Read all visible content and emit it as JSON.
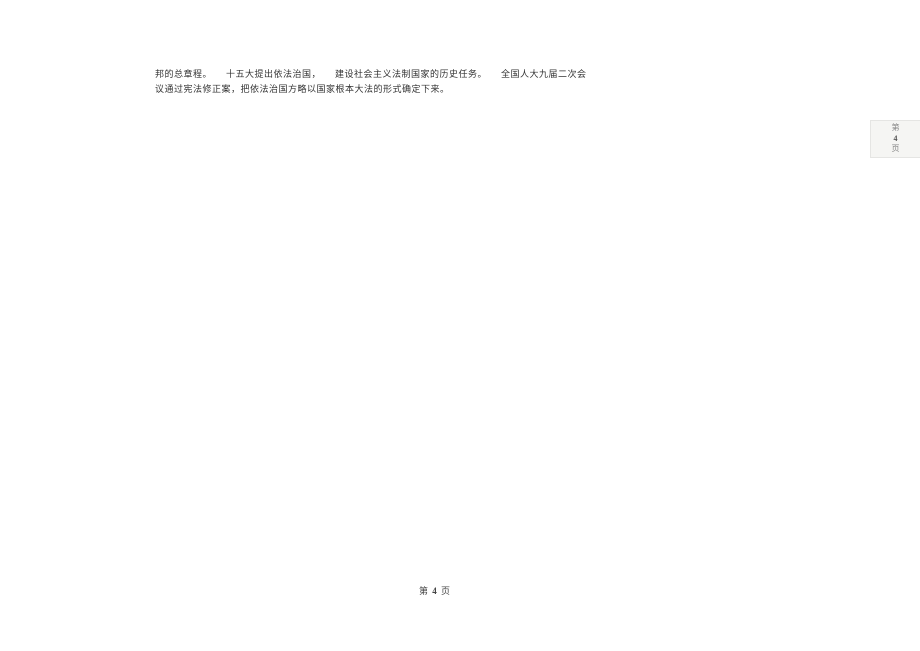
{
  "content": {
    "line1_seg1": "邦的总章程。",
    "line1_seg2": "十五大提出依法治国，",
    "line1_seg3": "建设社会主义法制国家的历史任务。",
    "line1_seg4": "全国人大九届二次会",
    "line2": "议通过宪法修正案，把依法治国方略以国家根本大法的形式确定下来。"
  },
  "footer": {
    "prefix": "第 ",
    "page_number": "4",
    "suffix": " 页"
  },
  "side_tab": {
    "top": "第",
    "number": "4",
    "bottom": "页"
  }
}
